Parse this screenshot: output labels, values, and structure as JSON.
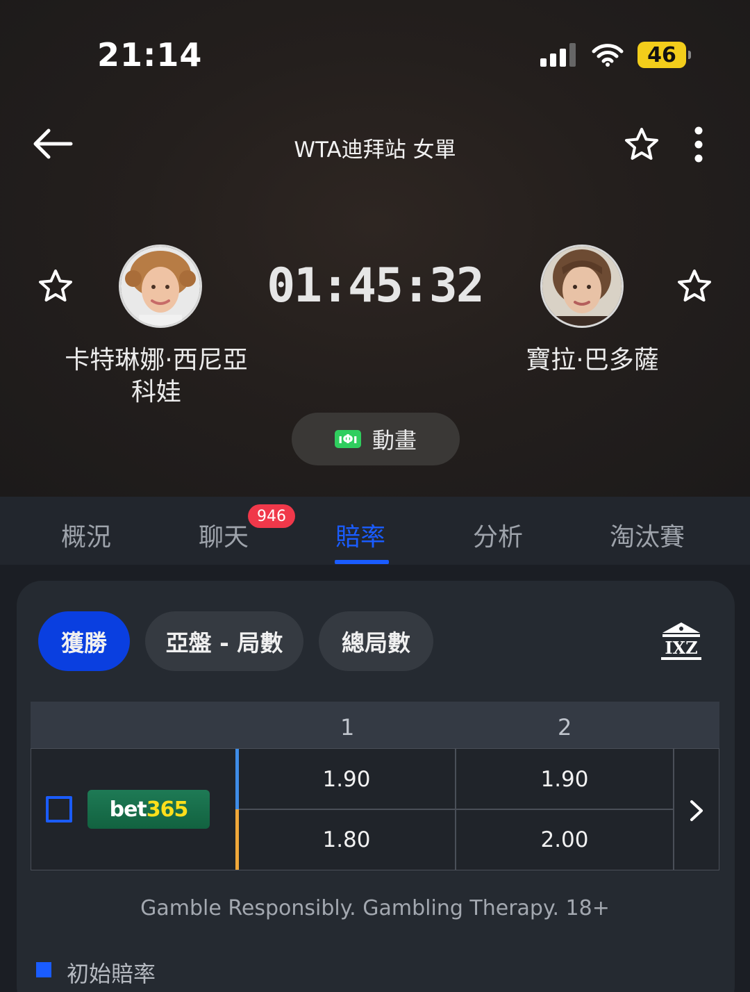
{
  "status_bar": {
    "time": "21:14",
    "battery": "46"
  },
  "header": {
    "title": "WTA迪拜站 女單"
  },
  "match": {
    "timer": "01:45:32",
    "player1": {
      "name_line1": "卡特琳娜·西尼亞",
      "name_line2": "科娃"
    },
    "player2": {
      "name": "寶拉·巴多薩"
    },
    "animation_label": "動畫",
    "animation_icon_text": "ıΦı"
  },
  "tabs": [
    {
      "label": "概況"
    },
    {
      "label": "聊天",
      "badge": "946"
    },
    {
      "label": "賠率",
      "active": true
    },
    {
      "label": "分析"
    },
    {
      "label": "淘汰賽"
    }
  ],
  "odds": {
    "filters": [
      "獲勝",
      "亞盤 - 局數",
      "總局數"
    ],
    "active_filter": "獲勝",
    "bank_icon_text": "IXZ",
    "columns": [
      "1",
      "2"
    ],
    "bookmaker": {
      "name_part1": "bet",
      "name_part2": "365"
    },
    "rows": [
      {
        "col1": "1.90",
        "col2": "1.90",
        "marker_color": "#3f8de8"
      },
      {
        "col1": "1.80",
        "col2": "2.00",
        "marker_color": "#f0a83a"
      }
    ],
    "disclaimer": "Gamble Responsibly. Gambling Therapy. 18+",
    "legend": "初始賠率"
  },
  "colors": {
    "accent": "#1a5cff",
    "badge": "#f0384a",
    "battery": "#f2cd1b",
    "anim_icon": "#2fce5e"
  }
}
